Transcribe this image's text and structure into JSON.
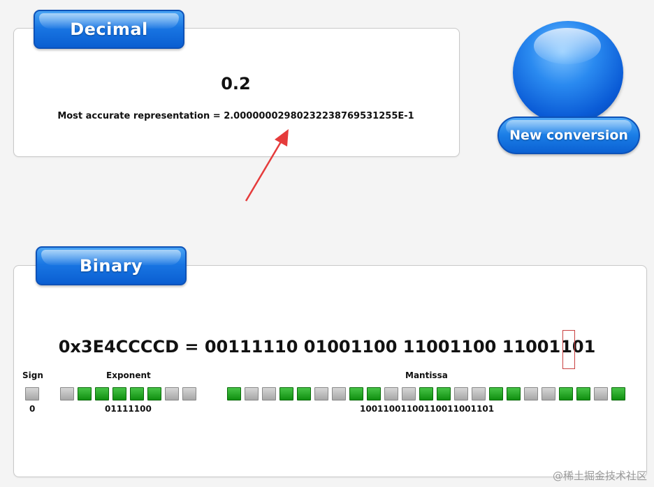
{
  "decimal": {
    "tab_label": "Decimal",
    "value": "0.2",
    "accurate_representation": "Most accurate representation = 2.00000002980232238769531255E-1"
  },
  "new_conversion_label": "New conversion",
  "binary": {
    "tab_label": "Binary",
    "hex_line": "0x3E4CCCCD = 00111110 01001100 11001100 11001101",
    "sign_label": "Sign",
    "sign_value": "0",
    "exponent_label": "Exponent",
    "exponent_value": "01111100",
    "mantissa_label": "Mantissa",
    "mantissa_value": "10011001100110011001101"
  },
  "colors": {
    "bit_on": "#1fa51f",
    "bit_off": "#b8b8b8",
    "accent_blue": "#1976e3",
    "annotation_red": "#e53b3b"
  },
  "watermark": "@稀土掘金技术社区"
}
